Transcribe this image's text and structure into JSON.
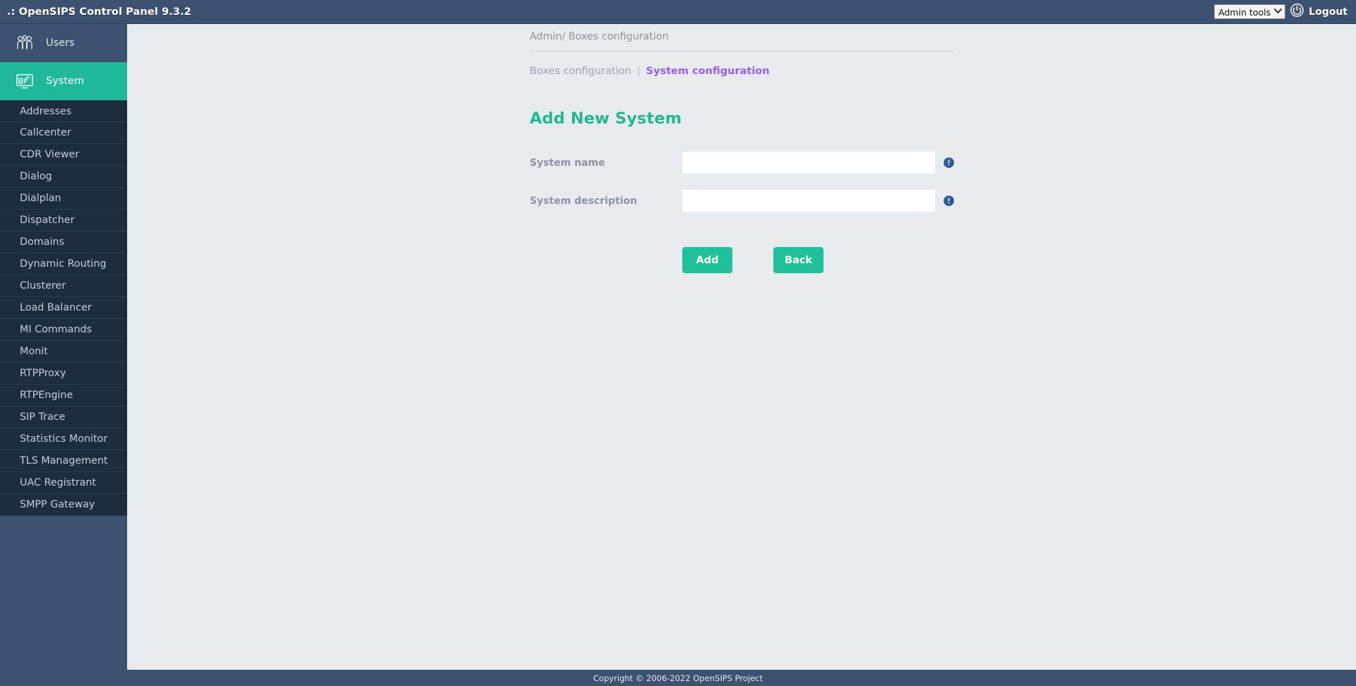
{
  "header": {
    "title": ".: OpenSIPS Control Panel 9.3.2",
    "admin_tools_label": "Admin tools",
    "admin_tools_options": [
      "Admin tools"
    ],
    "caret_icon": "chevron-down-icon",
    "power_icon": "power-icon",
    "logout_label": "Logout"
  },
  "sidebar": {
    "main": [
      {
        "label": "Users",
        "icon": "users-icon",
        "active": false
      },
      {
        "label": "System",
        "icon": "system-monitor-icon",
        "active": true
      }
    ],
    "submenu": [
      {
        "label": "Addresses"
      },
      {
        "label": "Callcenter"
      },
      {
        "label": "CDR Viewer"
      },
      {
        "label": "Dialog"
      },
      {
        "label": "Dialplan"
      },
      {
        "label": "Dispatcher"
      },
      {
        "label": "Domains"
      },
      {
        "label": "Dynamic Routing"
      },
      {
        "label": "Clusterer"
      },
      {
        "label": "Load Balancer"
      },
      {
        "label": "MI Commands"
      },
      {
        "label": "Monit"
      },
      {
        "label": "RTPProxy"
      },
      {
        "label": "RTPEngine"
      },
      {
        "label": "SIP Trace"
      },
      {
        "label": "Statistics Monitor"
      },
      {
        "label": "TLS Management"
      },
      {
        "label": "UAC Registrant"
      },
      {
        "label": "SMPP Gateway"
      }
    ]
  },
  "main": {
    "breadcrumb": "Admin/ Boxes configuration",
    "tabs": {
      "boxes_label": "Boxes configuration",
      "separator": "|",
      "system_label": "System configuration"
    },
    "form": {
      "title": "Add New System",
      "fields": [
        {
          "label": "System name",
          "value": "",
          "placeholder": "",
          "info_icon": "info-exclamation-icon"
        },
        {
          "label": "System description",
          "value": "",
          "placeholder": "",
          "info_icon": "info-exclamation-icon"
        }
      ],
      "buttons": {
        "add_label": "Add",
        "back_label": "Back"
      }
    }
  },
  "footer": {
    "copyright": "Copyright © 2006-2022 OpenSIPS Project"
  },
  "colors": {
    "header_navy": "#3d5270",
    "submenu_navy": "#1e2d3d",
    "accent_teal": "#1fb89a",
    "button_teal": "#1fc19b",
    "title_teal": "#23b88f",
    "active_tab_purple": "#9b5de5",
    "content_bg": "#e8ebed",
    "info_icon_blue": "#2d5e9e"
  }
}
